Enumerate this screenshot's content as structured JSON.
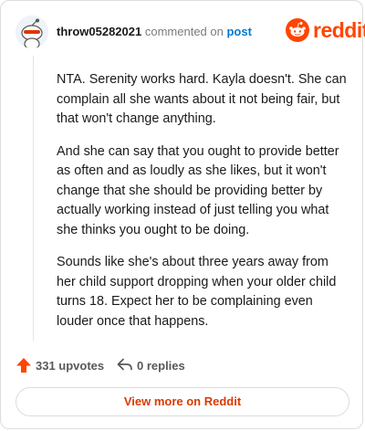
{
  "header": {
    "username": "throw05282021",
    "commented_on": "commented on",
    "post_link": "post",
    "brand": "reddit"
  },
  "comment": {
    "paragraphs": [
      "NTA. Serenity works hard. Kayla doesn't. She can complain all she wants about it not being fair, but that won't change anything.",
      "And she can say that you ought to provide better as often and as loudly as she likes, but it won't change that she should be providing better by actually working instead of just telling you what she thinks you ought to be doing.",
      "Sounds like she's about three years away from her child support dropping when your older child turns 18. Expect her to be complaining even louder once that happens."
    ]
  },
  "actions": {
    "upvotes": "331 upvotes",
    "replies": "0 replies"
  },
  "footer": {
    "view_more": "View more on Reddit"
  },
  "colors": {
    "brand": "#ff4500",
    "link": "#0079d3",
    "view_more_text": "#d93a00"
  },
  "icons": {
    "avatar": "snoo-avatar",
    "logo": "reddit-snoo-logo",
    "upvote": "upvote-arrow-icon",
    "reply": "reply-arrow-icon"
  }
}
